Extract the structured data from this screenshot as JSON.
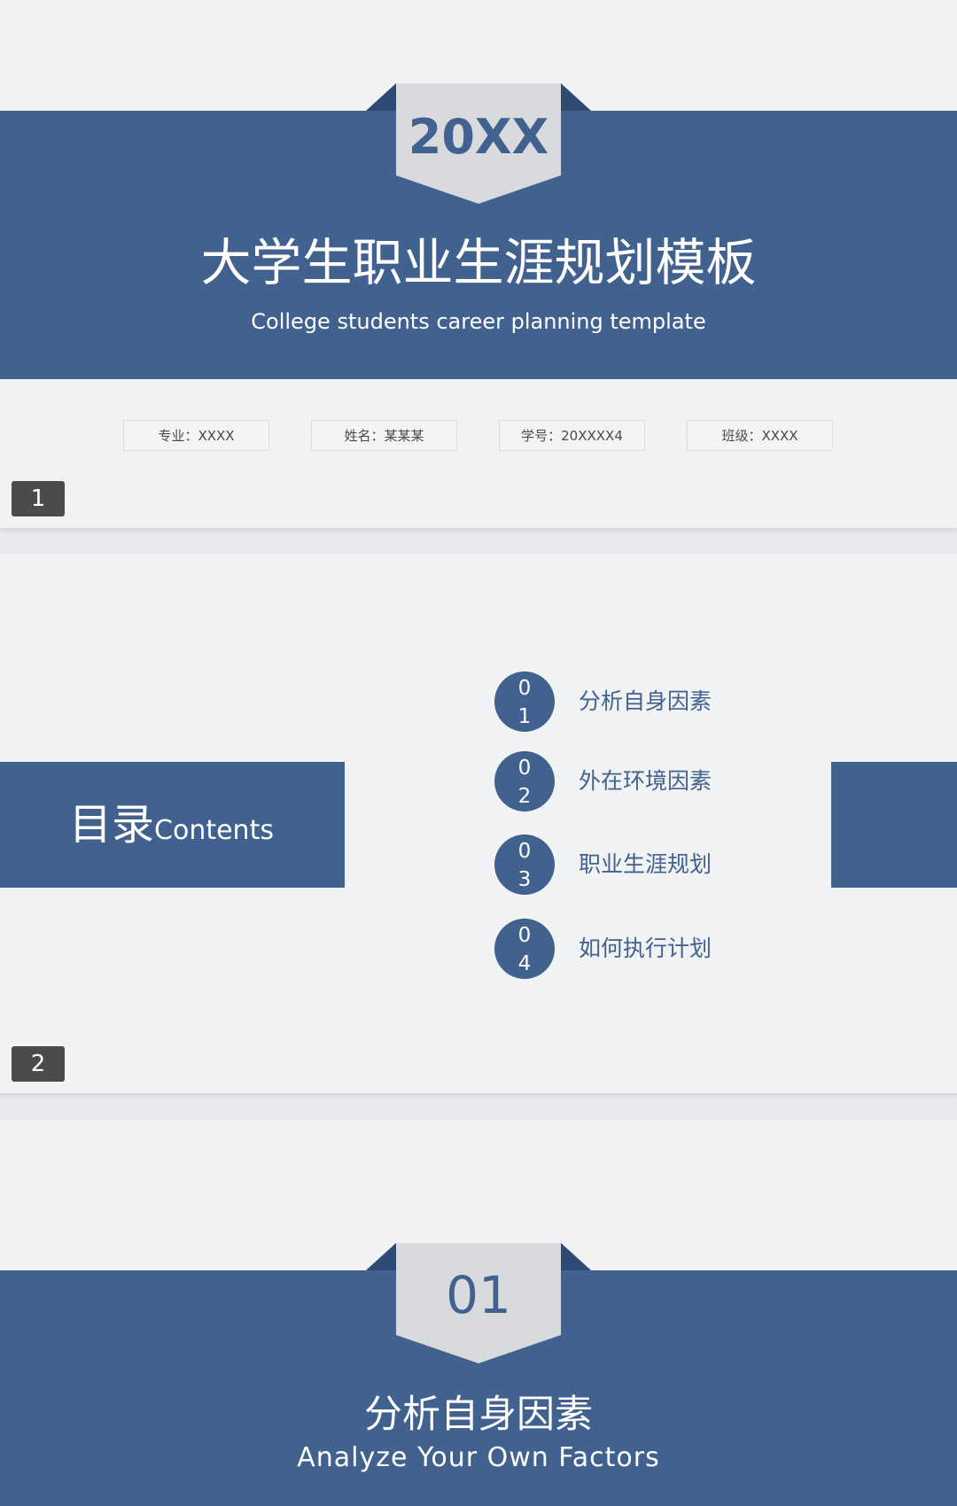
{
  "colors": {
    "band": "#41618e",
    "slide_bg": "#f1f2f4",
    "ribbon": "#d9dadd",
    "ribbon_fold": "#2e4a72",
    "page_badge": "#4b4b4b"
  },
  "slide1": {
    "year": "20XX",
    "title_cn": "大学生职业生涯规划模板",
    "title_en": "College students career planning template",
    "info": [
      "专业：XXXX",
      "姓名：某某某",
      "学号：20XXXX4",
      "班级：XXXX"
    ],
    "page_number": "1"
  },
  "slide2": {
    "heading_cn": "目录",
    "heading_en": "Contents",
    "items": [
      {
        "num_top": "0",
        "num_bottom": "1",
        "label": "分析自身因素"
      },
      {
        "num_top": "0",
        "num_bottom": "2",
        "label": "外在环境因素"
      },
      {
        "num_top": "0",
        "num_bottom": "3",
        "label": "职业生涯规划"
      },
      {
        "num_top": "0",
        "num_bottom": "4",
        "label": "如何执行计划"
      }
    ],
    "page_number": "2"
  },
  "slide3": {
    "section_number": "01",
    "title_cn": "分析自身因素",
    "title_en": "Analyze Your Own Factors"
  }
}
